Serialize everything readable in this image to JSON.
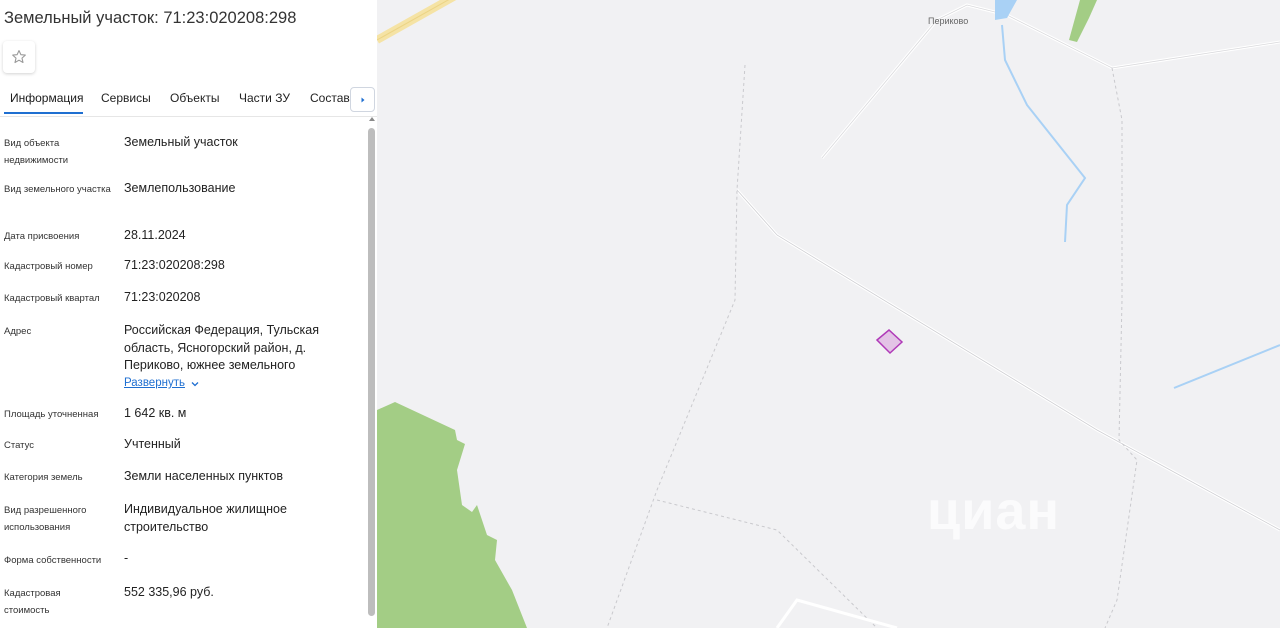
{
  "header": {
    "title": "Земельный участок: 71:23:020208:298"
  },
  "tabs": [
    {
      "label": "Информация"
    },
    {
      "label": "Сервисы"
    },
    {
      "label": "Объекты"
    },
    {
      "label": "Части ЗУ"
    },
    {
      "label": "Состав"
    }
  ],
  "fields": [
    {
      "label": "Вид объекта недвижимости",
      "value": "Земельный участок"
    },
    {
      "label": "Вид земельного участка",
      "value": "Землепользование"
    },
    {
      "label": "Дата присвоения",
      "value": "28.11.2024"
    },
    {
      "label": "Кадастровый номер",
      "value": "71:23:020208:298"
    },
    {
      "label": "Кадастровый квартал",
      "value": "71:23:020208"
    },
    {
      "label": "Адрес",
      "value": "Российская Федерация, Тульская область, Ясногорский район, д. Периково, южнее земельного"
    },
    {
      "label": "Площадь уточненная",
      "value": "1 642 кв. м"
    },
    {
      "label": "Статус",
      "value": "Учтенный"
    },
    {
      "label": "Категория земель",
      "value": "Земли населенных пунктов"
    },
    {
      "label": "Вид разрешенного использования",
      "value": "Индивидуальное жилищное строительство"
    },
    {
      "label": "Форма собственности",
      "value": "-"
    },
    {
      "label": "Кадастровая стоимость",
      "value": "552 335,96 руб."
    }
  ],
  "address_expand": {
    "label": "Развернуть"
  },
  "map": {
    "place_label": "Периково",
    "watermark": "циан",
    "colors": {
      "background": "#f1f1f3",
      "forest": "#a3cd85",
      "water": "#a9d1f5",
      "road": "#f5e3a5",
      "parcel_fill": "#e3c3e6",
      "parcel_stroke": "#b03ab8"
    }
  },
  "colors": {
    "accent": "#1f6fd1"
  }
}
